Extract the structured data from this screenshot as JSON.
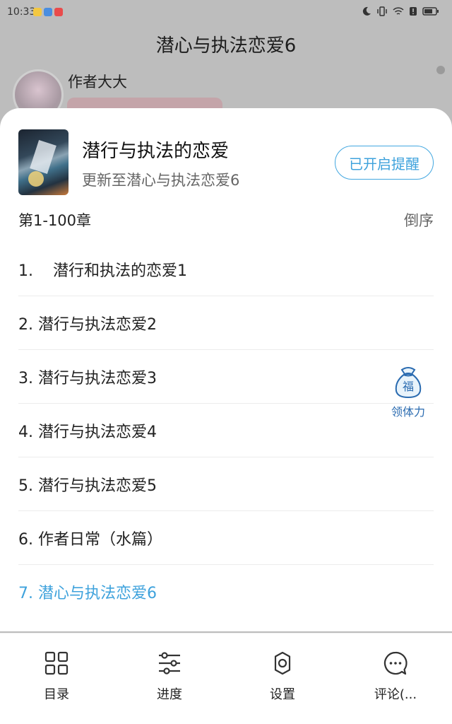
{
  "status_bar": {
    "time": "10:33",
    "app_icons": [
      {
        "name": "app-notify-icon-1",
        "color": "#f3c842"
      },
      {
        "name": "app-notify-icon-2",
        "color": "#4a8ee0"
      },
      {
        "name": "app-notify-icon-3",
        "color": "#e94b4b"
      }
    ],
    "right_icons": [
      "moon-icon",
      "vibrate-icon",
      "wifi-icon",
      "alert-icon",
      "battery-icon"
    ]
  },
  "reader": {
    "chapter_title": "潜心与执法恋爱6",
    "author_name": "作者大大"
  },
  "book": {
    "title": "潜行与执法的恋爱",
    "update_text": "更新至潜心与执法恋爱6",
    "remind_label": "已开启提醒"
  },
  "catalog": {
    "range_label": "第1-100章",
    "order_label": "倒序",
    "chapters": [
      {
        "label": "1.    潜行和执法的恋爱1",
        "current": false
      },
      {
        "label": "2. 潜行与执法恋爱2",
        "current": false
      },
      {
        "label": "3. 潜行与执法恋爱3",
        "current": false
      },
      {
        "label": "4. 潜行与执法恋爱4",
        "current": false
      },
      {
        "label": "5. 潜行与执法恋爱5",
        "current": false
      },
      {
        "label": "6. 作者日常（水篇）",
        "current": false
      },
      {
        "label": "7. 潜心与执法恋爱6",
        "current": true
      }
    ]
  },
  "gift": {
    "bag_char": "福",
    "label": "领体力"
  },
  "bottom_nav": [
    {
      "label": "目录",
      "icon": "grid-icon"
    },
    {
      "label": "进度",
      "icon": "sliders-icon"
    },
    {
      "label": "设置",
      "icon": "gear-icon"
    },
    {
      "label": "评论(...",
      "icon": "comment-icon"
    }
  ],
  "colors": {
    "accent": "#3ea2dc",
    "overlay": "#bdbdbd"
  }
}
